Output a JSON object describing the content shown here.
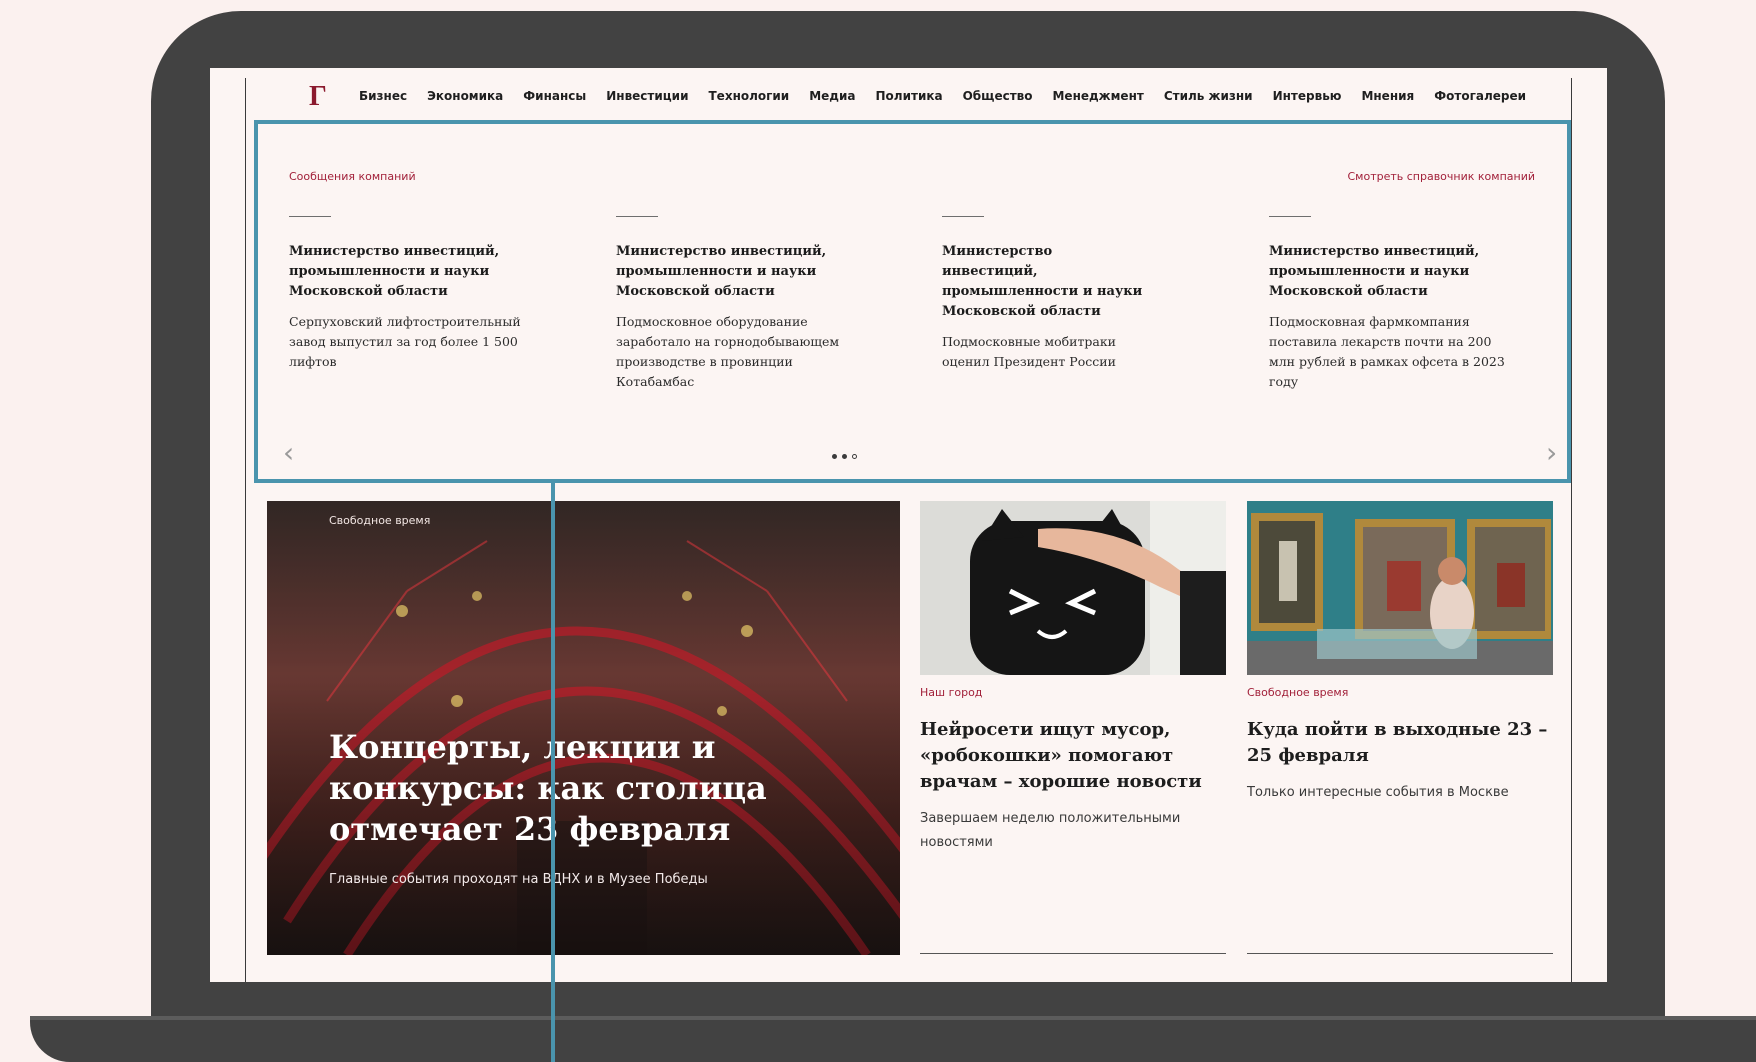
{
  "site": {
    "logo": "Г",
    "nav": [
      "Бизнес",
      "Экономика",
      "Финансы",
      "Инвестиции",
      "Технологии",
      "Медиа",
      "Политика",
      "Общество",
      "Менеджмент",
      "Стиль жизни",
      "Интервью",
      "Мнения",
      "Фотогалереи"
    ]
  },
  "press": {
    "label": "Сообщения компаний",
    "link": "Смотреть справочник компаний",
    "items": [
      {
        "source": "Министерство инвестиций, промышленности и науки Московской области",
        "text": "Серпуховский лифтостроительный завод выпустил за год более 1 500 лифтов"
      },
      {
        "source": "Министерство инвестиций, промышленности и науки Московской области",
        "text": "Подмосковное оборудование заработало на горнодобывающем производстве в провинции Котабамбас"
      },
      {
        "source": "Министерство инвестиций, промышленности и науки Московской области",
        "text": "Подмосковные мобитраки оценил Президент России"
      },
      {
        "source": "Министерство инвестиций, промышленности и науки Московской области",
        "text": "Подмосковная фармкомпания поставила лекарств почти на 200 млн рублей в рамках офсета в 2023 году"
      }
    ],
    "prev": "‹",
    "next": "›",
    "pages": 3,
    "active_page": 2
  },
  "hero": {
    "kicker": "Свободное время",
    "title": "Концерты, лекции и конкурсы: как столица отмечает 23 февраля",
    "subtitle": "Главные события проходят на ВДНХ и в Музее Победы"
  },
  "cards": [
    {
      "kicker": "Наш город",
      "title": "Нейросети ищут мусор, «робокошки» помогают врачам – хорошие новости",
      "desc": "Завершаем неделю положительными новостями"
    },
    {
      "kicker": "Свободное время",
      "title": "Куда пойти в выходные 23 – 25 февраля",
      "desc": "Только интересные события в Москве"
    }
  ],
  "colors": {
    "accent": "#a2213a",
    "highlight": "#4a94ad",
    "device": "#424242"
  }
}
